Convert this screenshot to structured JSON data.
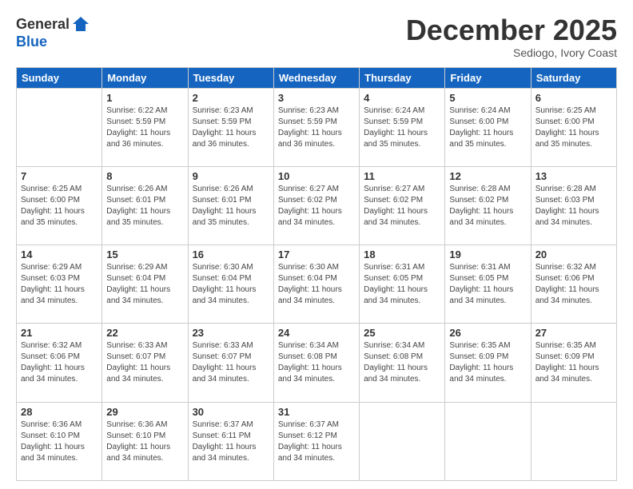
{
  "logo": {
    "general": "General",
    "blue": "Blue"
  },
  "header": {
    "month": "December 2025",
    "location": "Sediogo, Ivory Coast"
  },
  "weekdays": [
    "Sunday",
    "Monday",
    "Tuesday",
    "Wednesday",
    "Thursday",
    "Friday",
    "Saturday"
  ],
  "weeks": [
    [
      {
        "day": "",
        "sunrise": "",
        "sunset": "",
        "daylight": ""
      },
      {
        "day": "1",
        "sunrise": "Sunrise: 6:22 AM",
        "sunset": "Sunset: 5:59 PM",
        "daylight": "Daylight: 11 hours and 36 minutes."
      },
      {
        "day": "2",
        "sunrise": "Sunrise: 6:23 AM",
        "sunset": "Sunset: 5:59 PM",
        "daylight": "Daylight: 11 hours and 36 minutes."
      },
      {
        "day": "3",
        "sunrise": "Sunrise: 6:23 AM",
        "sunset": "Sunset: 5:59 PM",
        "daylight": "Daylight: 11 hours and 36 minutes."
      },
      {
        "day": "4",
        "sunrise": "Sunrise: 6:24 AM",
        "sunset": "Sunset: 5:59 PM",
        "daylight": "Daylight: 11 hours and 35 minutes."
      },
      {
        "day": "5",
        "sunrise": "Sunrise: 6:24 AM",
        "sunset": "Sunset: 6:00 PM",
        "daylight": "Daylight: 11 hours and 35 minutes."
      },
      {
        "day": "6",
        "sunrise": "Sunrise: 6:25 AM",
        "sunset": "Sunset: 6:00 PM",
        "daylight": "Daylight: 11 hours and 35 minutes."
      }
    ],
    [
      {
        "day": "7",
        "sunrise": "Sunrise: 6:25 AM",
        "sunset": "Sunset: 6:00 PM",
        "daylight": "Daylight: 11 hours and 35 minutes."
      },
      {
        "day": "8",
        "sunrise": "Sunrise: 6:26 AM",
        "sunset": "Sunset: 6:01 PM",
        "daylight": "Daylight: 11 hours and 35 minutes."
      },
      {
        "day": "9",
        "sunrise": "Sunrise: 6:26 AM",
        "sunset": "Sunset: 6:01 PM",
        "daylight": "Daylight: 11 hours and 35 minutes."
      },
      {
        "day": "10",
        "sunrise": "Sunrise: 6:27 AM",
        "sunset": "Sunset: 6:02 PM",
        "daylight": "Daylight: 11 hours and 34 minutes."
      },
      {
        "day": "11",
        "sunrise": "Sunrise: 6:27 AM",
        "sunset": "Sunset: 6:02 PM",
        "daylight": "Daylight: 11 hours and 34 minutes."
      },
      {
        "day": "12",
        "sunrise": "Sunrise: 6:28 AM",
        "sunset": "Sunset: 6:02 PM",
        "daylight": "Daylight: 11 hours and 34 minutes."
      },
      {
        "day": "13",
        "sunrise": "Sunrise: 6:28 AM",
        "sunset": "Sunset: 6:03 PM",
        "daylight": "Daylight: 11 hours and 34 minutes."
      }
    ],
    [
      {
        "day": "14",
        "sunrise": "Sunrise: 6:29 AM",
        "sunset": "Sunset: 6:03 PM",
        "daylight": "Daylight: 11 hours and 34 minutes."
      },
      {
        "day": "15",
        "sunrise": "Sunrise: 6:29 AM",
        "sunset": "Sunset: 6:04 PM",
        "daylight": "Daylight: 11 hours and 34 minutes."
      },
      {
        "day": "16",
        "sunrise": "Sunrise: 6:30 AM",
        "sunset": "Sunset: 6:04 PM",
        "daylight": "Daylight: 11 hours and 34 minutes."
      },
      {
        "day": "17",
        "sunrise": "Sunrise: 6:30 AM",
        "sunset": "Sunset: 6:04 PM",
        "daylight": "Daylight: 11 hours and 34 minutes."
      },
      {
        "day": "18",
        "sunrise": "Sunrise: 6:31 AM",
        "sunset": "Sunset: 6:05 PM",
        "daylight": "Daylight: 11 hours and 34 minutes."
      },
      {
        "day": "19",
        "sunrise": "Sunrise: 6:31 AM",
        "sunset": "Sunset: 6:05 PM",
        "daylight": "Daylight: 11 hours and 34 minutes."
      },
      {
        "day": "20",
        "sunrise": "Sunrise: 6:32 AM",
        "sunset": "Sunset: 6:06 PM",
        "daylight": "Daylight: 11 hours and 34 minutes."
      }
    ],
    [
      {
        "day": "21",
        "sunrise": "Sunrise: 6:32 AM",
        "sunset": "Sunset: 6:06 PM",
        "daylight": "Daylight: 11 hours and 34 minutes."
      },
      {
        "day": "22",
        "sunrise": "Sunrise: 6:33 AM",
        "sunset": "Sunset: 6:07 PM",
        "daylight": "Daylight: 11 hours and 34 minutes."
      },
      {
        "day": "23",
        "sunrise": "Sunrise: 6:33 AM",
        "sunset": "Sunset: 6:07 PM",
        "daylight": "Daylight: 11 hours and 34 minutes."
      },
      {
        "day": "24",
        "sunrise": "Sunrise: 6:34 AM",
        "sunset": "Sunset: 6:08 PM",
        "daylight": "Daylight: 11 hours and 34 minutes."
      },
      {
        "day": "25",
        "sunrise": "Sunrise: 6:34 AM",
        "sunset": "Sunset: 6:08 PM",
        "daylight": "Daylight: 11 hours and 34 minutes."
      },
      {
        "day": "26",
        "sunrise": "Sunrise: 6:35 AM",
        "sunset": "Sunset: 6:09 PM",
        "daylight": "Daylight: 11 hours and 34 minutes."
      },
      {
        "day": "27",
        "sunrise": "Sunrise: 6:35 AM",
        "sunset": "Sunset: 6:09 PM",
        "daylight": "Daylight: 11 hours and 34 minutes."
      }
    ],
    [
      {
        "day": "28",
        "sunrise": "Sunrise: 6:36 AM",
        "sunset": "Sunset: 6:10 PM",
        "daylight": "Daylight: 11 hours and 34 minutes."
      },
      {
        "day": "29",
        "sunrise": "Sunrise: 6:36 AM",
        "sunset": "Sunset: 6:10 PM",
        "daylight": "Daylight: 11 hours and 34 minutes."
      },
      {
        "day": "30",
        "sunrise": "Sunrise: 6:37 AM",
        "sunset": "Sunset: 6:11 PM",
        "daylight": "Daylight: 11 hours and 34 minutes."
      },
      {
        "day": "31",
        "sunrise": "Sunrise: 6:37 AM",
        "sunset": "Sunset: 6:12 PM",
        "daylight": "Daylight: 11 hours and 34 minutes."
      },
      {
        "day": "",
        "sunrise": "",
        "sunset": "",
        "daylight": ""
      },
      {
        "day": "",
        "sunrise": "",
        "sunset": "",
        "daylight": ""
      },
      {
        "day": "",
        "sunrise": "",
        "sunset": "",
        "daylight": ""
      }
    ]
  ]
}
